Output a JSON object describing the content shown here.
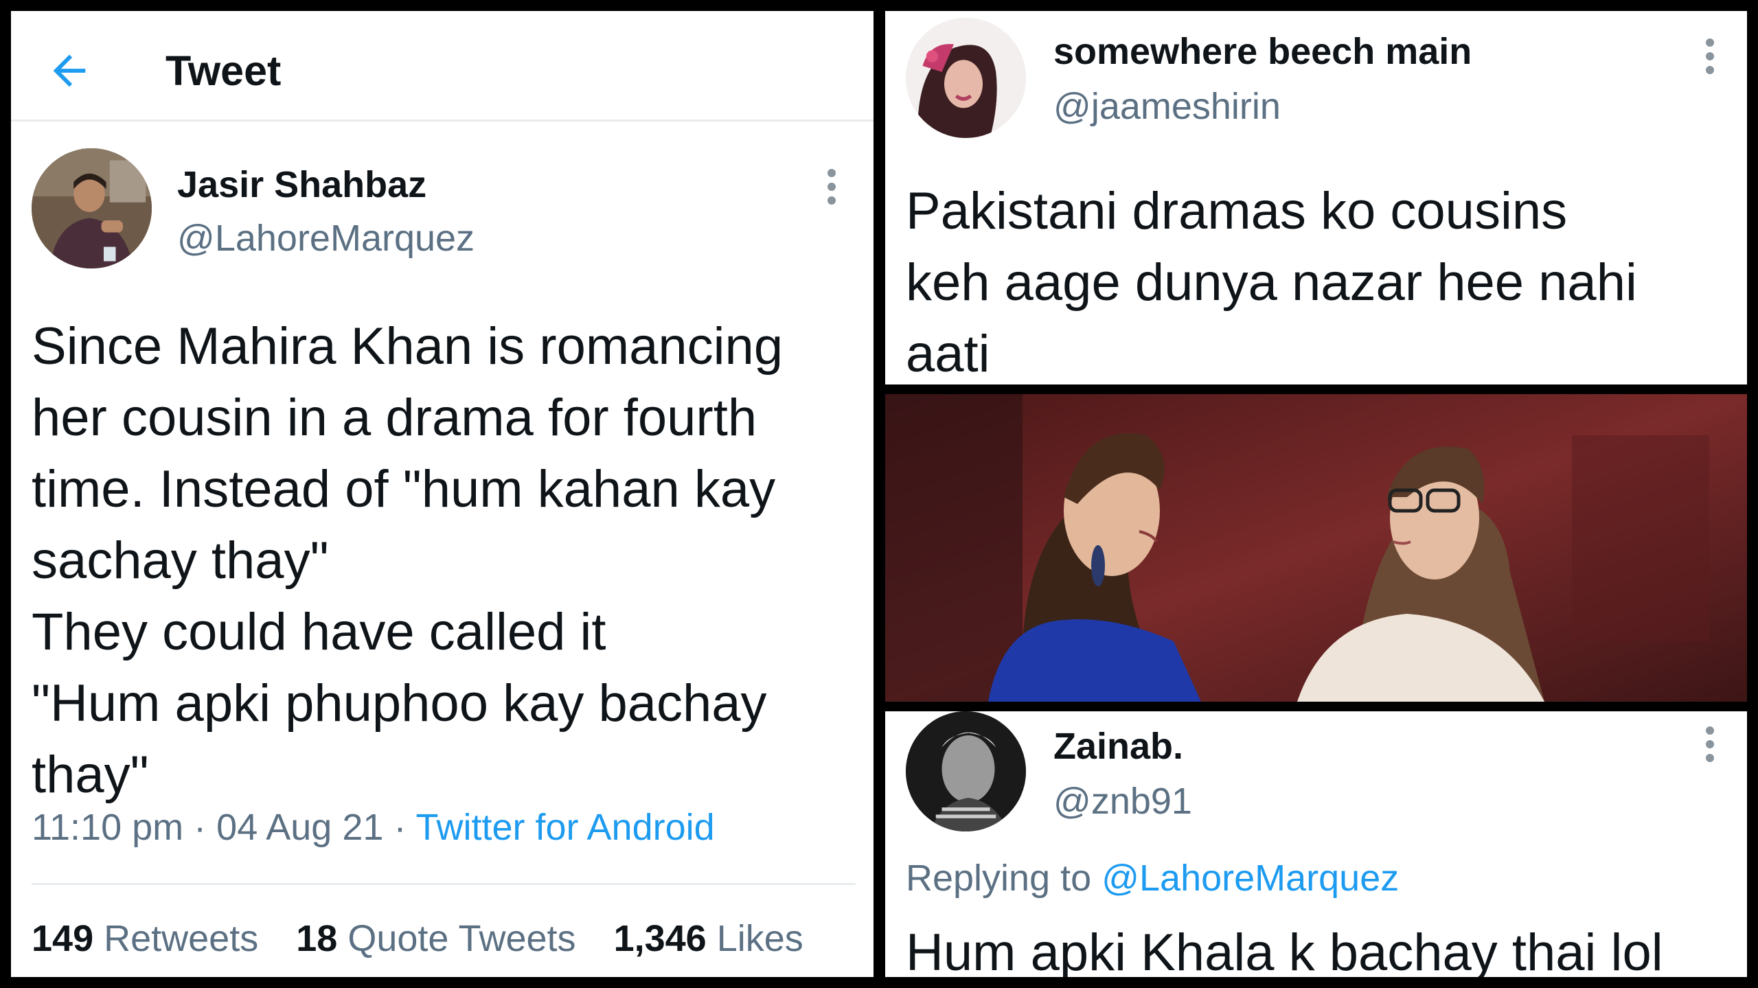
{
  "left_tweet": {
    "header_title": "Tweet",
    "author_name": "Jasir Shahbaz",
    "author_handle": "@LahoreMarquez",
    "text_lines": [
      "Since Mahira Khan is romancing",
      "her cousin in a drama for fourth",
      "time. Instead of \"hum kahan kay",
      "sachay thay\"",
      "They could have called it",
      "\"Hum apki phuphoo kay bachay",
      "thay\""
    ],
    "time": "11:10 pm",
    "date": "04 Aug 21",
    "source": "Twitter for Android",
    "stats": {
      "retweets_count": "149",
      "retweets_label": "Retweets",
      "quotes_count": "18",
      "quotes_label": "Quote Tweets",
      "likes_count": "1,346",
      "likes_label": "Likes"
    }
  },
  "reply_one": {
    "author_name": "somewhere beech main",
    "author_handle": "@jaameshirin",
    "text_lines": [
      "Pakistani dramas ko cousins",
      "keh aage dunya nazar hee nahi",
      "aati"
    ]
  },
  "reply_two": {
    "author_name": "Zainab.",
    "author_handle": "@znb91",
    "replying_label": "Replying to",
    "replying_handle": "@LahoreMarquez",
    "text": "Hum apki Khala k bachay thai lol"
  },
  "colors": {
    "accent": "#1d9bf0",
    "text_primary": "#0f1419",
    "text_secondary": "#5b7083",
    "divider": "#e8ecef"
  },
  "icons": [
    "back-arrow-icon",
    "more-options-icon"
  ]
}
